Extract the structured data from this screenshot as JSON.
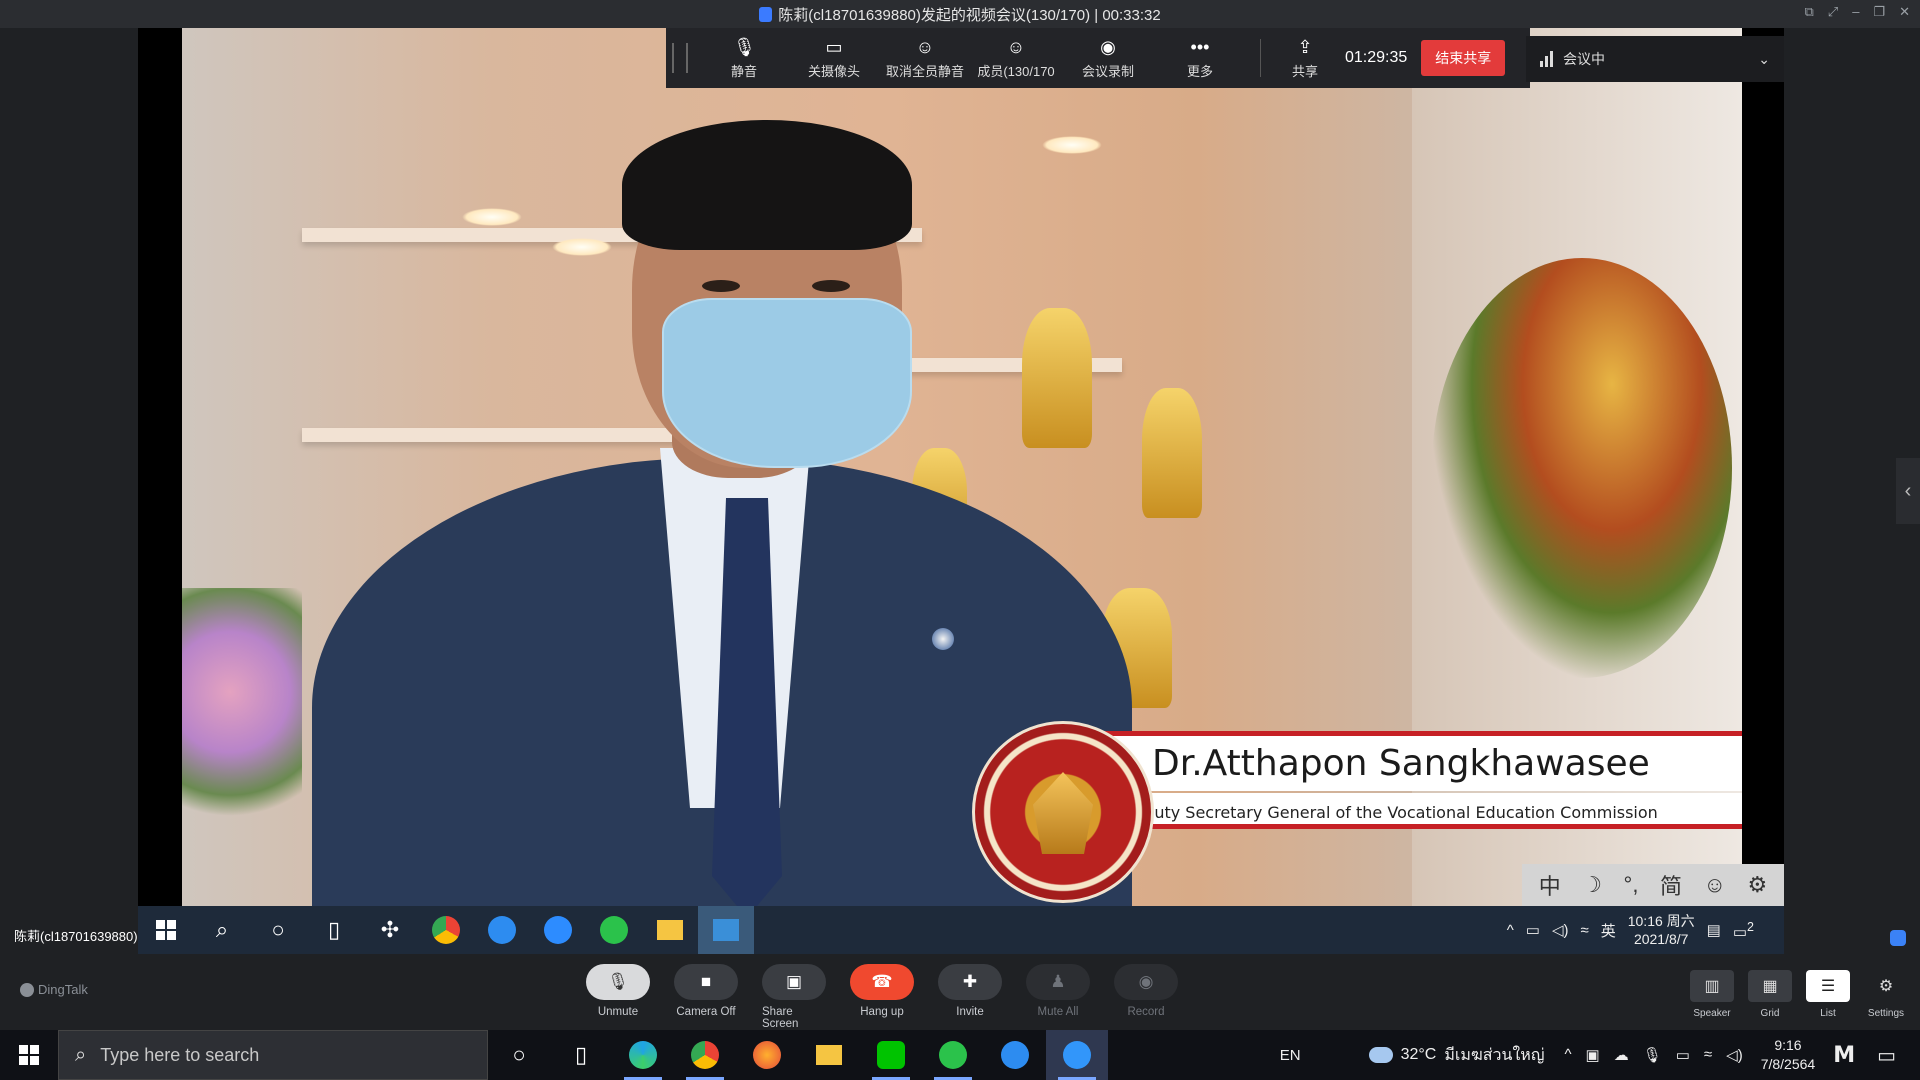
{
  "window": {
    "title": "陈莉(cl18701639880)发起的视频会议(130/170) | 00:33:32"
  },
  "meeting_toolbar": {
    "items": [
      {
        "label": "静音",
        "icon": "microphone-icon"
      },
      {
        "label": "关摄像头",
        "icon": "camera-icon"
      },
      {
        "label": "取消全员静音",
        "icon": "unmute-all-icon"
      },
      {
        "label": "成员(130/170",
        "icon": "members-icon"
      },
      {
        "label": "会议录制",
        "icon": "record-icon"
      },
      {
        "label": "更多",
        "icon": "more-icon"
      },
      {
        "label": "共享",
        "icon": "share-icon"
      }
    ],
    "timer": "01:29:35",
    "end_share_label": "结束共享"
  },
  "status_pill": {
    "label": "会议中"
  },
  "video": {
    "caption_name": "Dr.Atthapon Sangkhawasee",
    "caption_role": "Deputy Secretary General of the Vocational Education Commission"
  },
  "remote_taskbar": {
    "presenter": "陈莉(cl18701639880)",
    "ime_lang": "英",
    "clock_time": "10:16 周六",
    "clock_date": "2021/8/7",
    "notification_count": "2",
    "ime_items": [
      "中",
      "☽",
      "°,",
      "简",
      "☺",
      "⚙"
    ]
  },
  "meeting_bar": {
    "brand": "DingTalk",
    "controls": [
      {
        "label": "Unmute",
        "icon": "microphone-icon"
      },
      {
        "label": "Camera Off",
        "icon": "camera-icon"
      },
      {
        "label": "Share Screen",
        "icon": "share-screen-icon"
      },
      {
        "label": "Hang up",
        "icon": "hangup-icon"
      },
      {
        "label": "Invite",
        "icon": "invite-icon"
      },
      {
        "label": "Mute All",
        "icon": "mute-all-icon"
      },
      {
        "label": "Record",
        "icon": "record-icon"
      }
    ],
    "views": [
      {
        "label": "Speaker",
        "icon": "speaker-view-icon"
      },
      {
        "label": "Grid",
        "icon": "grid-view-icon"
      },
      {
        "label": "List",
        "icon": "list-view-icon"
      }
    ],
    "settings_label": "Settings"
  },
  "win_taskbar": {
    "search_placeholder": "Type here to search",
    "lang": "EN",
    "temperature": "32°C",
    "location": "มีเมฆส่วนใหญ่",
    "clock_time": "9:16",
    "clock_date": "7/8/2564",
    "brand_glyph": "M"
  },
  "colors": {
    "end_share": "#e33b3b",
    "hangup": "#f0492f",
    "caption_red": "#c62025",
    "accent_blue": "#3b7bff"
  }
}
